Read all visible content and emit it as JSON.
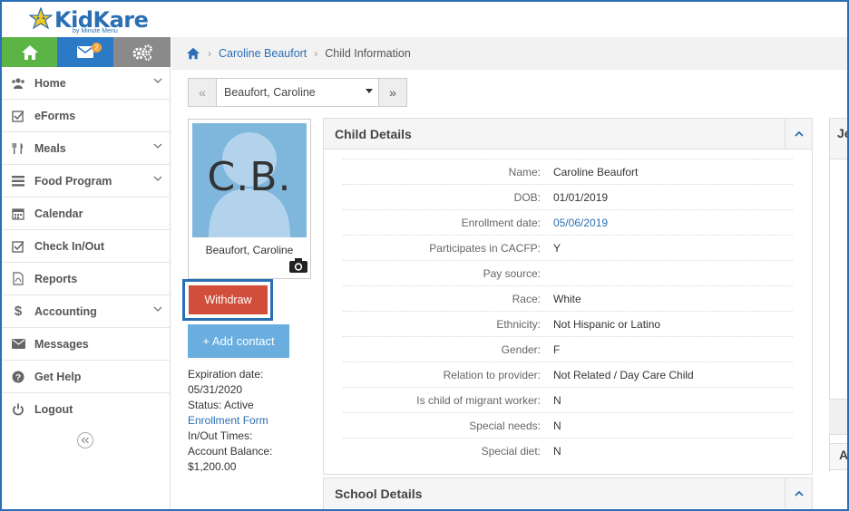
{
  "brand": {
    "name": "KidKare",
    "tagline": "by Minute Menu",
    "colors": {
      "primary": "#2a6fb5",
      "green": "#5db446",
      "red": "#d14f3a",
      "lightblue": "#6aaee0"
    }
  },
  "topbar": {
    "mail_badge": "2"
  },
  "sidebar": {
    "items": [
      {
        "label": "Home",
        "icon": "users-icon",
        "has_chevron": true
      },
      {
        "label": "eForms",
        "icon": "checkbox-icon",
        "has_chevron": false
      },
      {
        "label": "Meals",
        "icon": "utensils-icon",
        "has_chevron": true
      },
      {
        "label": "Food Program",
        "icon": "list-icon",
        "has_chevron": true
      },
      {
        "label": "Calendar",
        "icon": "calendar-icon",
        "has_chevron": false
      },
      {
        "label": "Check In/Out",
        "icon": "checkbox-icon",
        "has_chevron": false
      },
      {
        "label": "Reports",
        "icon": "pdf-icon",
        "has_chevron": false
      },
      {
        "label": "Accounting",
        "icon": "dollar-icon",
        "has_chevron": true
      },
      {
        "label": "Messages",
        "icon": "envelope-icon",
        "has_chevron": false
      },
      {
        "label": "Get Help",
        "icon": "question-icon",
        "has_chevron": false
      },
      {
        "label": "Logout",
        "icon": "power-icon",
        "has_chevron": false
      }
    ]
  },
  "breadcrumb": {
    "link": "Caroline Beaufort",
    "current": "Child Information"
  },
  "child_nav": {
    "selected": "Beaufort, Caroline"
  },
  "profile": {
    "initials": "C.B.",
    "name": "Beaufort, Caroline",
    "withdraw_label": "Withdraw",
    "add_contact_label": "+ Add contact",
    "expiration_label": "Expiration date:",
    "expiration_value": "05/31/2020",
    "status": "Status: Active",
    "enrollment_form": "Enrollment Form",
    "in_out_times": "In/Out Times:",
    "balance_label": "Account Balance:",
    "balance_value": "$1,200.00"
  },
  "child_details": {
    "title": "Child Details",
    "rows": [
      {
        "label": "Name:",
        "value": "Caroline Beaufort"
      },
      {
        "label": "DOB:",
        "value": "01/01/2019"
      },
      {
        "label": "Enrollment date:",
        "value": "05/06/2019"
      },
      {
        "label": "Participates in CACFP:",
        "value": "Y"
      },
      {
        "label": "Pay source:",
        "value": ""
      },
      {
        "label": "Race:",
        "value": "White"
      },
      {
        "label": "Ethnicity:",
        "value": "Not Hispanic or Latino"
      },
      {
        "label": "Gender:",
        "value": "F"
      },
      {
        "label": "Relation to provider:",
        "value": "Not Related / Day Care Child"
      },
      {
        "label": "Is child of migrant worker:",
        "value": "N"
      },
      {
        "label": "Special needs:",
        "value": "N"
      },
      {
        "label": "Special diet:",
        "value": "N"
      }
    ]
  },
  "school_details": {
    "title": "School Details"
  },
  "side_panels": {
    "first": "Je",
    "second": "A"
  }
}
